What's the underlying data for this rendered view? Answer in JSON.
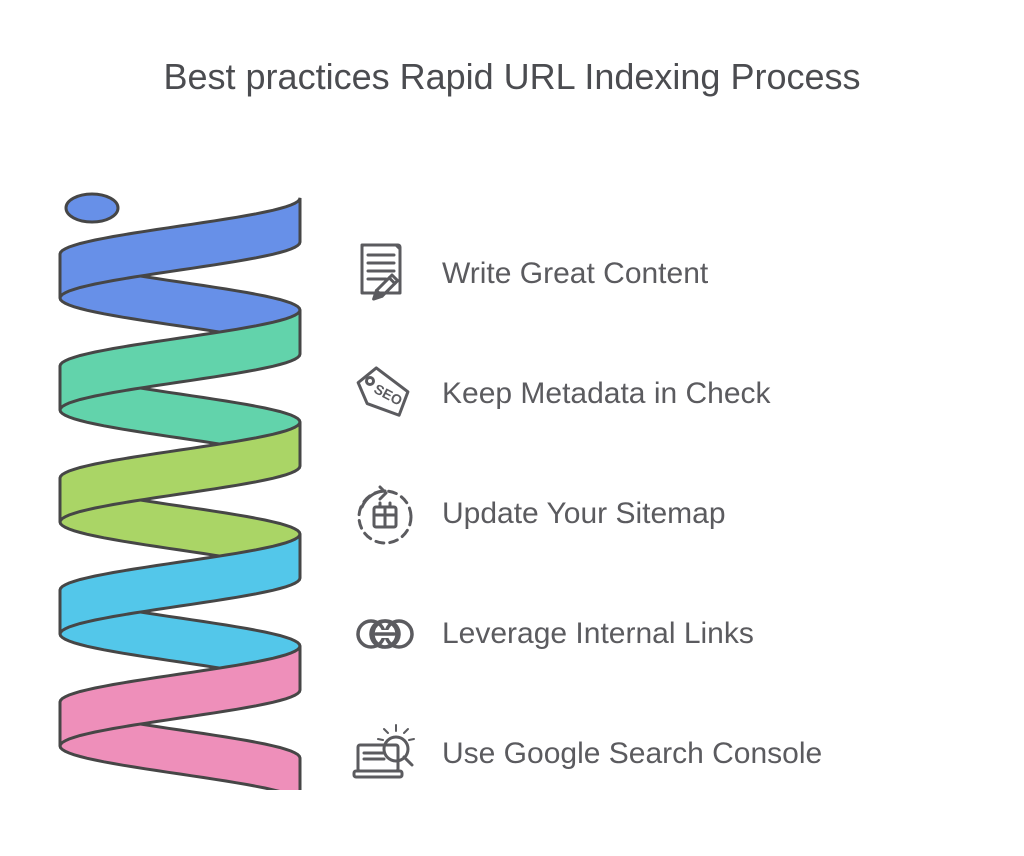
{
  "title": "Best practices Rapid URL Indexing Process",
  "spring": {
    "colors": [
      "#6790e8",
      "#62d3ab",
      "#aad566",
      "#53c7ea",
      "#ee8fba"
    ],
    "outline": "#464646"
  },
  "items": [
    {
      "icon": "write-content-icon",
      "label": "Write Great Content"
    },
    {
      "icon": "seo-tag-icon",
      "label": "Keep Metadata in Check"
    },
    {
      "icon": "sitemap-update-icon",
      "label": "Update Your Sitemap"
    },
    {
      "icon": "internal-links-icon",
      "label": "Leverage Internal Links"
    },
    {
      "icon": "search-console-icon",
      "label": "Use Google Search Console"
    }
  ]
}
